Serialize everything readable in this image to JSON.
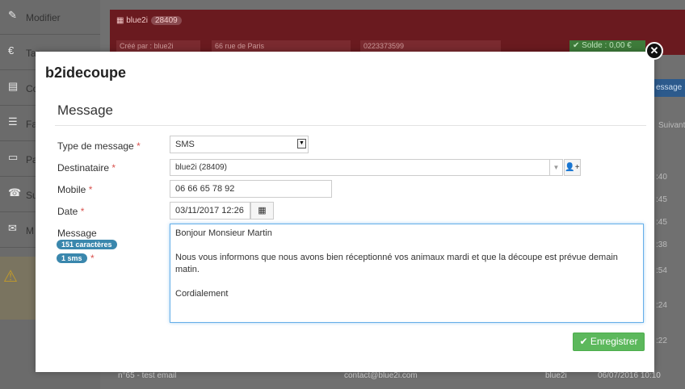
{
  "background": {
    "sidebar": [
      {
        "icon": "edit-icon",
        "label": "Modifier"
      },
      {
        "icon": "euro-icon",
        "label": "Tar"
      },
      {
        "icon": "document-icon",
        "label": "Co"
      },
      {
        "icon": "list-icon",
        "label": "Fa"
      },
      {
        "icon": "card-icon",
        "label": "Pa"
      },
      {
        "icon": "phone-icon",
        "label": "Su"
      },
      {
        "icon": "mail-icon",
        "label": "M"
      }
    ],
    "client_name": "blue2i",
    "client_badge": "28409",
    "created_by": "Créé par : blue2i",
    "address": "66 rue de Paris",
    "phone": "0223373599",
    "solde": "✔ Solde : 0,00 €",
    "message_btn": "essage",
    "suivant": "Suivant",
    "times": [
      ":40",
      ":45",
      ":45",
      ":38",
      ":54",
      ":24",
      ":22"
    ],
    "bottom_row": {
      "title": "n°65 - test email",
      "email": "contact@blue2i.com",
      "user": "blue2i",
      "datetime": "06/07/2016 10:10"
    }
  },
  "modal": {
    "title": "b2idecoupe",
    "section": "Message",
    "labels": {
      "type": "Type de message",
      "destinataire": "Destinataire",
      "mobile": "Mobile",
      "date": "Date",
      "message": "Message"
    },
    "required_mark": "*",
    "type_value": "SMS",
    "destinataire_value": "blue2i (28409)",
    "mobile_value": "06 66 65 78 92",
    "date_value": "03/11/2017 12:26",
    "char_count": "151 caractères",
    "sms_count": "1 sms",
    "message_lines": [
      "Bonjour Monsieur Martin",
      "",
      "Nous vous informons que nous avons bien réceptionné vos animaux mardi et que la découpe est prévue demain matin.",
      "",
      "Cordialement"
    ],
    "save_label": "Enregistrer"
  }
}
